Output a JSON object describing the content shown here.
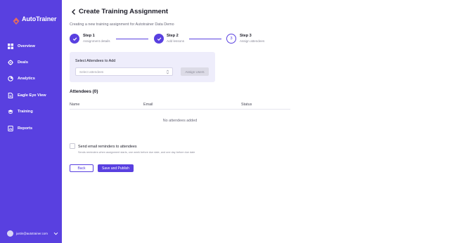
{
  "brand": {
    "name": "AutoTrainer",
    "logo_icon": "autotrainer-logo-icon"
  },
  "sidebar": {
    "items": [
      {
        "label": "Overview",
        "icon": "grid-icon"
      },
      {
        "label": "Deals",
        "icon": "gear-icon"
      },
      {
        "label": "Analytics",
        "icon": "pie-chart-icon"
      },
      {
        "label": "Eagle Eye View",
        "icon": "document-icon"
      },
      {
        "label": "Training",
        "icon": "graduation-cap-icon"
      },
      {
        "label": "Reports",
        "icon": "report-icon"
      }
    ],
    "user": {
      "email": "justin@autotrainer.com",
      "icon": "chevron-down-icon"
    }
  },
  "page": {
    "title": "Create Training Assignment",
    "subtitle": "Creating a new training assignment for Autotrainer Data Demo"
  },
  "stepper": {
    "steps": [
      {
        "title": "Step 1",
        "desc": "Assignment details",
        "state": "done"
      },
      {
        "title": "Step 2",
        "desc": "Add lessons",
        "state": "done"
      },
      {
        "title": "Step 3",
        "desc": "Assign attendees",
        "state": "active",
        "number": "3"
      }
    ]
  },
  "select_card": {
    "title": "Select Attendees to Add",
    "placeholder": "Select attendees",
    "assign_label": "Assign Users"
  },
  "attendees": {
    "heading": "Attendees (0)",
    "columns": [
      "Name",
      "Email",
      "Status"
    ],
    "empty_text": "No attendees added"
  },
  "reminder": {
    "label": "Send email reminders to attendees",
    "help": "Sends reminders when assignment starts, one week before due date, and one day before due date"
  },
  "actions": {
    "back_label": "Back",
    "publish_label": "Save and Publish"
  },
  "colors": {
    "accent": "#5940e0",
    "sidebar_bg": "#5940e0",
    "card_bg": "#eeedfb",
    "logo": "#f07055"
  }
}
